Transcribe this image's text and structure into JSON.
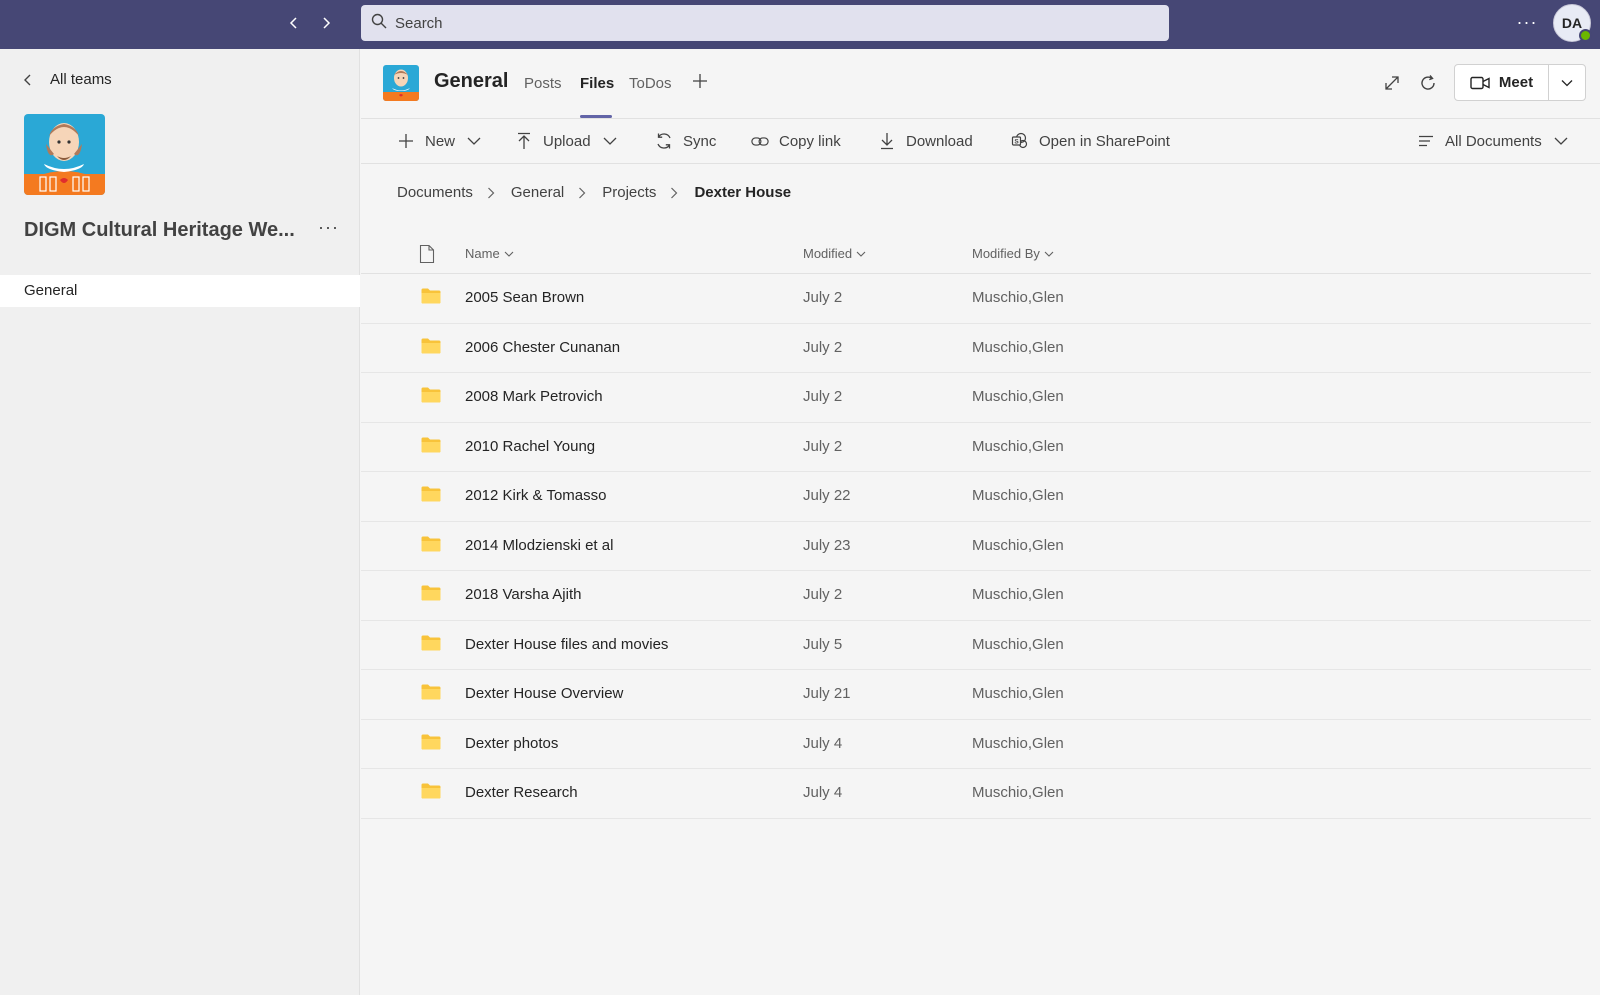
{
  "topbar": {
    "search_placeholder": "Search",
    "more": "···",
    "avatar_initials": "DA"
  },
  "sidebar": {
    "back_label": "All teams",
    "team_name": "DIGM Cultural Heritage We...",
    "team_more": "···",
    "channels": [
      {
        "label": "General"
      }
    ]
  },
  "header": {
    "channel_title": "General",
    "tabs": [
      {
        "label": "Posts"
      },
      {
        "label": "Files"
      },
      {
        "label": "ToDos"
      }
    ],
    "active_tab": "Files",
    "meet_label": "Meet"
  },
  "toolbar": {
    "new": "New",
    "upload": "Upload",
    "sync": "Sync",
    "copy_link": "Copy link",
    "download": "Download",
    "open_sharepoint": "Open in SharePoint",
    "view": "All Documents"
  },
  "breadcrumb": [
    "Documents",
    "General",
    "Projects",
    "Dexter House"
  ],
  "columns": {
    "name": "Name",
    "modified": "Modified",
    "modified_by": "Modified By"
  },
  "files": [
    {
      "name": "2005 Sean Brown",
      "modified": "July 2",
      "modified_by": "Muschio,Glen"
    },
    {
      "name": "2006 Chester Cunanan",
      "modified": "July 2",
      "modified_by": "Muschio,Glen"
    },
    {
      "name": "2008 Mark Petrovich",
      "modified": "July 2",
      "modified_by": "Muschio,Glen"
    },
    {
      "name": "2010 Rachel Young",
      "modified": "July 2",
      "modified_by": "Muschio,Glen"
    },
    {
      "name": "2012 Kirk & Tomasso",
      "modified": "July 22",
      "modified_by": "Muschio,Glen"
    },
    {
      "name": "2014 Mlodzienski et al",
      "modified": "July 23",
      "modified_by": "Muschio,Glen"
    },
    {
      "name": "2018 Varsha Ajith",
      "modified": "July 2",
      "modified_by": "Muschio,Glen"
    },
    {
      "name": "Dexter House files and movies",
      "modified": "July 5",
      "modified_by": "Muschio,Glen"
    },
    {
      "name": "Dexter House Overview",
      "modified": "July 21",
      "modified_by": "Muschio,Glen"
    },
    {
      "name": "Dexter photos",
      "modified": "July 4",
      "modified_by": "Muschio,Glen"
    },
    {
      "name": "Dexter Research",
      "modified": "July 4",
      "modified_by": "Muschio,Glen"
    }
  ],
  "colors": {
    "topbar": "#464775",
    "accent": "#6264a7",
    "folder": "#f8c33a",
    "logo_bg": "#2aa8d6",
    "logo_orange": "#f47a20"
  },
  "icons": [
    "chevron-left-icon",
    "chevron-right-icon",
    "search-icon",
    "more-icon",
    "popout-icon",
    "refresh-icon",
    "video-icon",
    "plus-icon",
    "upload-icon",
    "sync-icon",
    "link-icon",
    "download-icon",
    "sharepoint-icon",
    "list-view-icon",
    "folder-icon",
    "file-icon"
  ]
}
